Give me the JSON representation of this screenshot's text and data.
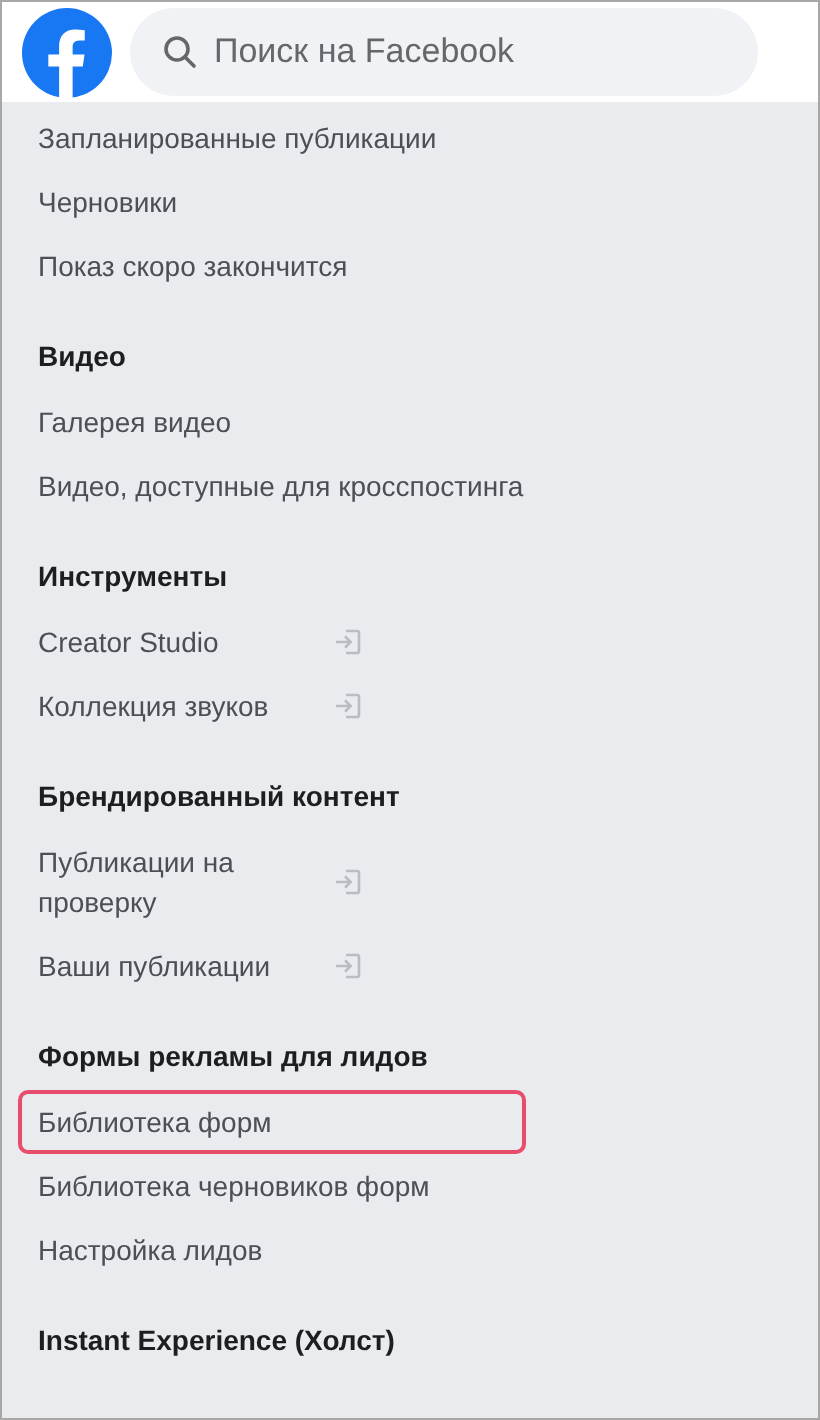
{
  "search": {
    "placeholder": "Поиск на Facebook"
  },
  "sections": [
    {
      "items": [
        {
          "label": "Запланированные публикации",
          "external": false,
          "selected": false
        },
        {
          "label": "Черновики",
          "external": false,
          "selected": false
        },
        {
          "label": "Показ скоро закончится",
          "external": false,
          "selected": false
        }
      ]
    },
    {
      "title": "Видео",
      "items": [
        {
          "label": "Галерея видео",
          "external": false,
          "selected": false
        },
        {
          "label": "Видео, доступные для кросспостинга",
          "external": false,
          "selected": false
        }
      ]
    },
    {
      "title": "Инструменты",
      "items": [
        {
          "label": "Creator Studio",
          "external": true,
          "selected": false
        },
        {
          "label": "Коллекция звуков",
          "external": true,
          "selected": false
        }
      ]
    },
    {
      "title": "Брендированный контент",
      "items": [
        {
          "label": "Публикации на проверку",
          "external": true,
          "selected": false
        },
        {
          "label": "Ваши публикации",
          "external": true,
          "selected": false
        }
      ]
    },
    {
      "title": "Формы рекламы для лидов",
      "items": [
        {
          "label": "Библиотека форм",
          "external": false,
          "selected": true
        },
        {
          "label": "Библиотека черновиков форм",
          "external": false,
          "selected": false
        },
        {
          "label": "Настройка лидов",
          "external": false,
          "selected": false
        }
      ]
    },
    {
      "title": "Instant Experience (Холст)"
    }
  ]
}
